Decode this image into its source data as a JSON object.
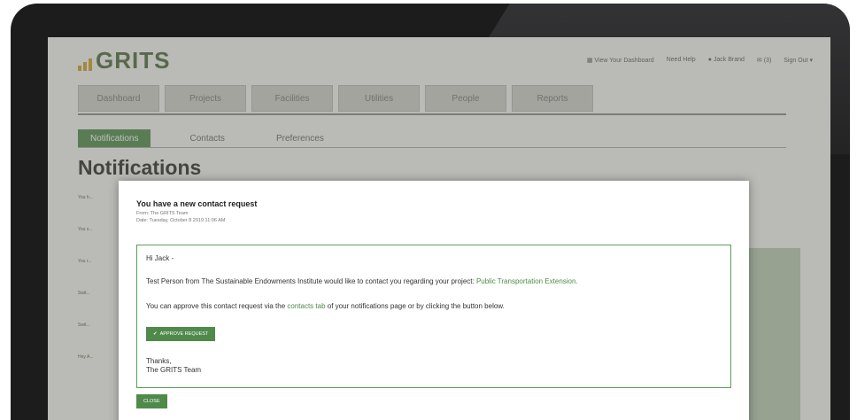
{
  "app": {
    "logo": "GRITS",
    "accent": "#4f8a4a",
    "logo_bars_color": "#c9a227"
  },
  "topmenu": {
    "items": [
      {
        "icon": "tile-icon",
        "label": "View Your Dashboard"
      },
      {
        "label": "Need Help"
      },
      {
        "icon": "user-icon",
        "label": "Jack Brand"
      },
      {
        "icon": "mail-icon",
        "label": "(3)"
      },
      {
        "label": "Sign Out"
      }
    ]
  },
  "nav": {
    "tabs": [
      "Dashboard",
      "Projects",
      "Facilities",
      "Utilities",
      "People",
      "Reports"
    ]
  },
  "subtabs": [
    {
      "label": "Notifications",
      "active": true
    },
    {
      "label": "Contacts",
      "active": false
    },
    {
      "label": "Preferences",
      "active": false
    }
  ],
  "page": {
    "title": "Notifications",
    "list": [
      "You h...",
      "You s...",
      "You r...",
      "Swit...",
      "Swit...",
      "Hey A..."
    ]
  },
  "modal": {
    "title": "You have a new contact request",
    "from": "From: The GRITS Team",
    "date": "Date: Tuesday, October 8 2019 11:06 AM",
    "greeting": "Hi Jack -",
    "line1_pre": "Test Person from The Sustainable Endowments Institute would like to contact you regarding your project: ",
    "line1_link": "Public Transportation Extension.",
    "line2_pre": "You can approve this contact request via the ",
    "line2_link": "contacts tab",
    "line2_post": " of your notifications page or by clicking the button below.",
    "approve_label": "APPROVE REQUEST",
    "thanks": "Thanks,",
    "team": "The GRITS Team",
    "close_label": "CLOSE"
  }
}
